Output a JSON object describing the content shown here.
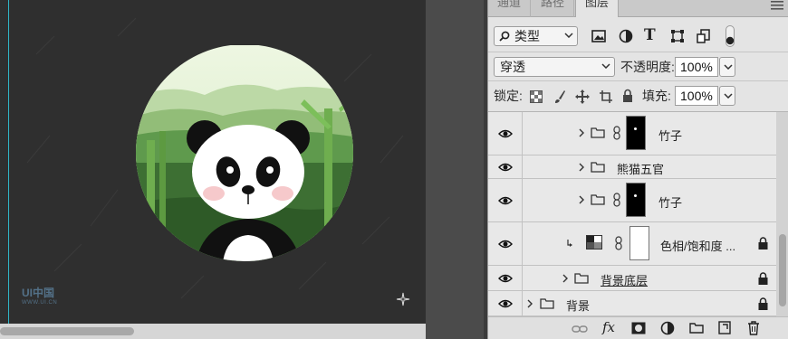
{
  "tabs": [
    {
      "label": "通道",
      "active": false
    },
    {
      "label": "路径",
      "active": false
    },
    {
      "label": "图层",
      "active": true
    }
  ],
  "filter": {
    "label": "类型"
  },
  "blend_mode": {
    "value": "穿透"
  },
  "opacity": {
    "label": "不透明度:",
    "value": "100%"
  },
  "lock": {
    "label": "锁定:"
  },
  "fill": {
    "label": "填充:",
    "value": "100%"
  },
  "layers": [
    {
      "name": "竹子",
      "type": "group-masked",
      "visible": true
    },
    {
      "name": "熊猫五官",
      "type": "group",
      "visible": true
    },
    {
      "name": "竹子",
      "type": "group-masked",
      "visible": true
    },
    {
      "name": "色相/饱和度 ...",
      "type": "adjustment",
      "visible": true,
      "locked": true
    },
    {
      "name": "背景底层",
      "type": "group",
      "visible": true,
      "locked": true
    },
    {
      "name": "背景",
      "type": "group",
      "visible": true,
      "locked": true
    }
  ],
  "watermark": {
    "title": "UI中国",
    "subtitle": "WWW.UI.CN"
  },
  "colors": {
    "canvas": "#2f2f2f",
    "panel": "#e4e4e4",
    "guide": "#2fb5c7"
  }
}
